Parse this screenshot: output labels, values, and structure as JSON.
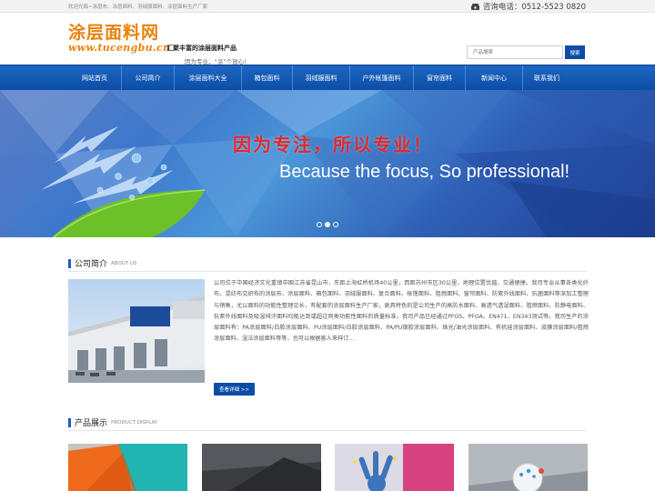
{
  "topbar": {
    "welcome": "欢迎光临~涂层布、涂层面料、羽绒服面料、涂层面料生产厂家",
    "hotline": "咨询电话：0512-5523 0820"
  },
  "header": {
    "logo_cn": "涂层面料网",
    "logo_en": "www.tucengbu.cn",
    "slogan_1": "汇聚丰富的涂层面料产品",
    "slogan_2": "因为专业，“涂”个放心!"
  },
  "search": {
    "placeholder": "产品搜索",
    "button": "搜索"
  },
  "nav": {
    "items": [
      "网站首页",
      "公司简介",
      "涂层面料大全",
      "箱包面料",
      "羽绒服面料",
      "户外帐篷面料",
      "窗帘面料",
      "新闻中心",
      "联系我们"
    ]
  },
  "banner": {
    "cn": "因为专注，所以专业！",
    "en": "Because the focus, So professional!",
    "slide_count": 3,
    "active_slide": 2
  },
  "about": {
    "title_cn": "公司简介",
    "title_en": "ABOUT US",
    "text": "公司位于中国经济文化重镇中国江苏省昆山市，东距上海虹桥机场40公里，西距苏州市区30公里，地理位置优越，交通便捷。我司专业从事各类化纤布、混纺布交织布的涂层布、涂层面料、箱包面料、羽绒服面料、复合面料、帐篷面料、阻燃面料、窗帘面料、防紫外线面料、抗菌面料等深加工整理与销售，尤以面料的功能性整理见长，有配套的涂层面料生产厂家，更具特色的是公司生产的高防水面料、高透气透湿面料、阻燃面料、防静电面料、抗紫外线面料及吸湿排汗面料均能达到或超过同类功能性面料的质量标准，我司产品已经通过PFOS、PFOA、EN471、EN343测试等。我司生产的涂层面料有：PA涂层面料/白胶涂层面料、PU涂层面料/白胶涂层面料、PA/PU银胶涂层面料、珠光/油光涂层面料、有机硅涂层面料、皮膜涂层面料/阻燃涂层面料、湿法涂层面料等等，也可以根据客人来样订...",
    "more": "查看详细 >>"
  },
  "products": {
    "title_cn": "产品展示",
    "title_en": "PRODUCT DISPLAY"
  },
  "colors": {
    "brand_blue": "#0e4da5",
    "logo_orange": "#e8820a",
    "banner_red": "#e32828"
  }
}
